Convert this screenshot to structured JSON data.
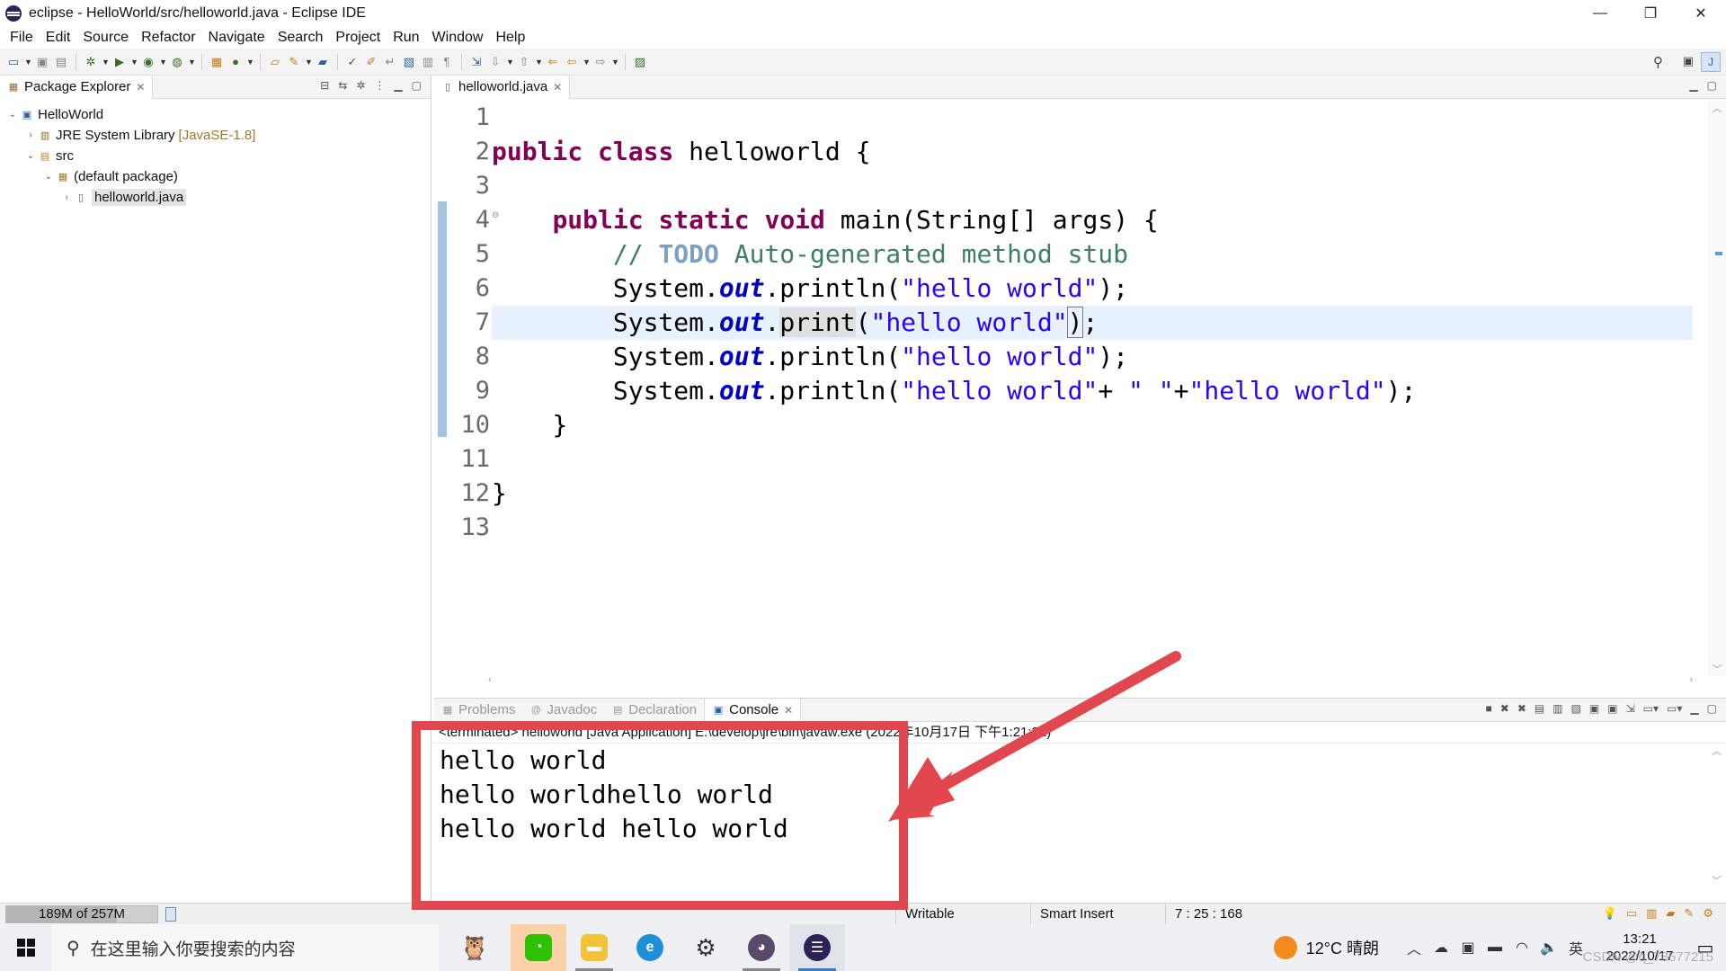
{
  "window": {
    "title": "eclipse - HelloWorld/src/helloworld.java - Eclipse IDE",
    "minimize": "—",
    "maximize": "❐",
    "close": "✕"
  },
  "menu": [
    "File",
    "Edit",
    "Source",
    "Refactor",
    "Navigate",
    "Search",
    "Project",
    "Run",
    "Window",
    "Help"
  ],
  "package_explorer": {
    "tab_label": "Package Explorer",
    "tree": {
      "project": "HelloWorld",
      "jre_label": "JRE System Library",
      "jre_decor": "[JavaSE-1.8]",
      "src": "src",
      "package": "(default package)",
      "file": "helloworld.java"
    }
  },
  "editor": {
    "tab_label": "helloworld.java",
    "line_numbers": [
      "1",
      "2",
      "3",
      "4",
      "5",
      "6",
      "7",
      "8",
      "9",
      "10",
      "11",
      "12",
      "13"
    ],
    "code": {
      "l2_kw1": "public",
      "l2_kw2": "class",
      "l2_rest": " helloworld {",
      "l4_kw1": "public",
      "l4_kw2": "static",
      "l4_kw3": "void",
      "l4_rest": " main(String[] args) {",
      "l5_comment1": "// ",
      "l5_todo": "TODO",
      "l5_comment2": " Auto-generated method stub",
      "sys": "System.",
      "out": "out",
      "println": ".println(",
      "print_dot": ".",
      "print": "print",
      "paren_open": "(",
      "paren_close": ")",
      "semi_close": ");",
      "semi": ";",
      "str_hello": "\"hello world\"",
      "l9_plus1": "+",
      "l9_space": "\" \"",
      "l9_plus2": "+",
      "close_method": "}",
      "close_class": "}"
    }
  },
  "console": {
    "tabs": {
      "problems": "Problems",
      "javadoc": "Javadoc",
      "declaration": "Declaration",
      "console": "Console"
    },
    "info_line": "<terminated> helloworld [Java Application] E:\\develop\\jre\\bin\\javaw.exe (2022年10月17日 下午1:21:31)",
    "output": [
      "hello world",
      "hello worldhello world",
      "hello world hello world"
    ]
  },
  "statusbar": {
    "heap": "189M of 257M",
    "heap_fraction": 0.735,
    "writable": "Writable",
    "insert_mode": "Smart Insert",
    "position": "7 : 25 : 168"
  },
  "taskbar": {
    "search_placeholder": "在这里输入你要搜索的内容",
    "weather": "12°C  晴朗",
    "ime": "英",
    "time": "13:21",
    "date": "2022/10/17",
    "watermark": "CSDN @q_78577215"
  },
  "colors": {
    "keyword": "#7f0055",
    "string": "#2a00ff",
    "comment": "#3f7f5f",
    "field": "#0000c0",
    "annotation": "#e0474f"
  }
}
